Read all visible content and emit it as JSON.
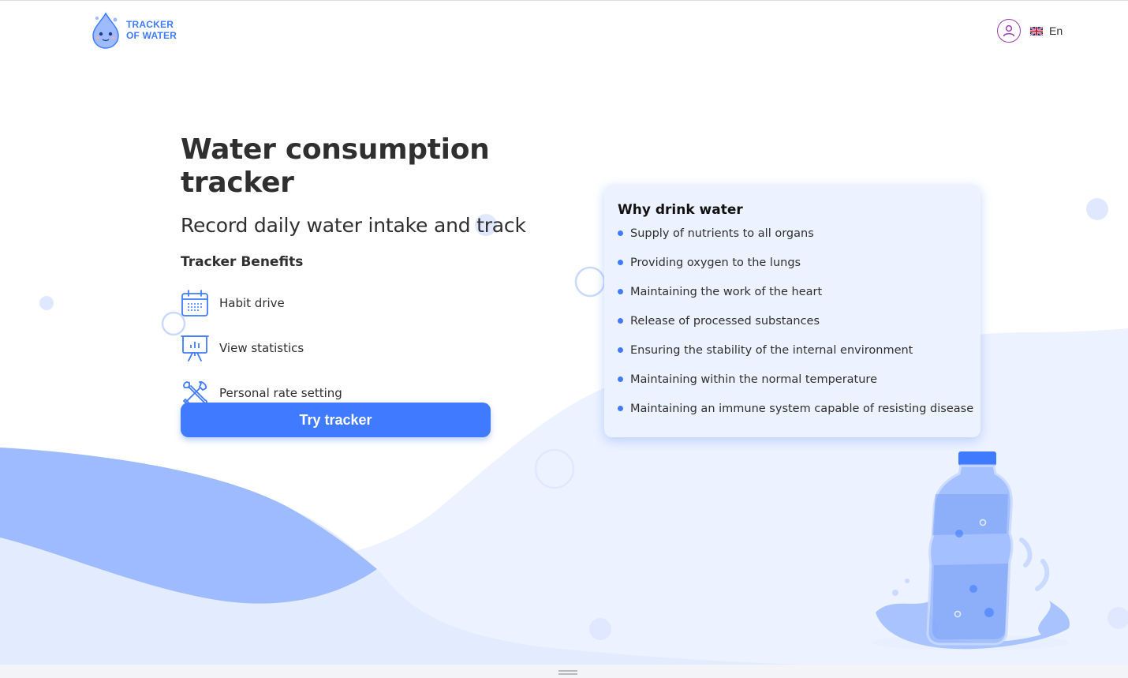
{
  "header": {
    "logo_line1": "TRACKER",
    "logo_line2": "OF WATER",
    "language": "En"
  },
  "hero": {
    "title": "Water consumption tracker",
    "subtitle": "Record daily water intake and track",
    "benefits_heading": "Tracker Benefits",
    "benefits": [
      {
        "label": "Habit drive",
        "icon": "calendar-icon"
      },
      {
        "label": "View statistics",
        "icon": "statistics-icon"
      },
      {
        "label": "Personal rate setting",
        "icon": "tools-icon"
      }
    ],
    "cta_label": "Try tracker"
  },
  "why": {
    "title": "Why drink water",
    "items": [
      "Supply of nutrients to all organs",
      "Providing oxygen to the lungs",
      "Maintaining the work of the heart",
      "Release of processed substances",
      "Ensuring the stability of the internal environment",
      "Maintaining within the normal temperature",
      "Maintaining an immune system capable of resisting disease"
    ]
  },
  "colors": {
    "accent": "#407bff",
    "card_bg": "#ecf2ff",
    "wave_light": "#ecf2ff",
    "wave_mid": "#9ebbff",
    "user_icon": "#9b3fb0"
  }
}
